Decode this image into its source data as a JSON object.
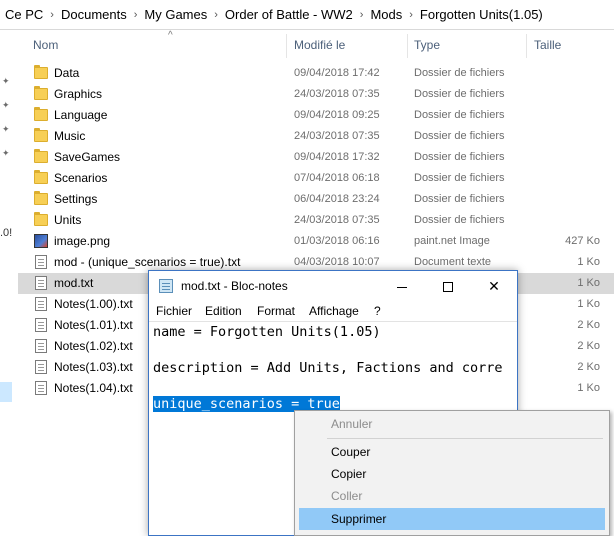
{
  "breadcrumb": [
    "Ce PC",
    "Documents",
    "My Games",
    "Order of Battle - WW2",
    "Mods",
    "Forgotten Units(1.05)"
  ],
  "breadcrumb_separator": "›",
  "nav_fragment": ".0!",
  "columns": {
    "name": "Nom",
    "date": "Modifié le",
    "type": "Type",
    "size": "Taille",
    "sort_indicator": "^"
  },
  "files": [
    {
      "name": "Data",
      "date": "09/04/2018 17:42",
      "type": "Dossier de fichiers",
      "size": "",
      "icon": "folder-icon"
    },
    {
      "name": "Graphics",
      "date": "24/03/2018 07:35",
      "type": "Dossier de fichiers",
      "size": "",
      "icon": "folder-icon"
    },
    {
      "name": "Language",
      "date": "09/04/2018 09:25",
      "type": "Dossier de fichiers",
      "size": "",
      "icon": "folder-icon"
    },
    {
      "name": "Music",
      "date": "24/03/2018 07:35",
      "type": "Dossier de fichiers",
      "size": "",
      "icon": "folder-icon"
    },
    {
      "name": "SaveGames",
      "date": "09/04/2018 17:32",
      "type": "Dossier de fichiers",
      "size": "",
      "icon": "folder-icon"
    },
    {
      "name": "Scenarios",
      "date": "07/04/2018 06:18",
      "type": "Dossier de fichiers",
      "size": "",
      "icon": "folder-icon"
    },
    {
      "name": "Settings",
      "date": "06/04/2018 23:24",
      "type": "Dossier de fichiers",
      "size": "",
      "icon": "folder-icon"
    },
    {
      "name": "Units",
      "date": "24/03/2018 07:35",
      "type": "Dossier de fichiers",
      "size": "",
      "icon": "folder-icon"
    },
    {
      "name": "image.png",
      "date": "01/03/2018 06:16",
      "type": "paint.net Image",
      "size": "427 Ko",
      "icon": "image-file-icon"
    },
    {
      "name": "mod - (unique_scenarios = true).txt",
      "date": "04/03/2018 10:07",
      "type": "Document texte",
      "size": "1 Ko",
      "icon": "text-file-icon"
    },
    {
      "name": "mod.txt",
      "date": "",
      "type": "",
      "size": "1 Ko",
      "icon": "text-file-icon"
    },
    {
      "name": "Notes(1.00).txt",
      "date": "",
      "type": "",
      "size": "1 Ko",
      "icon": "text-file-icon"
    },
    {
      "name": "Notes(1.01).txt",
      "date": "",
      "type": "",
      "size": "2 Ko",
      "icon": "text-file-icon"
    },
    {
      "name": "Notes(1.02).txt",
      "date": "",
      "type": "",
      "size": "2 Ko",
      "icon": "text-file-icon"
    },
    {
      "name": "Notes(1.03).txt",
      "date": "",
      "type": "",
      "size": "2 Ko",
      "icon": "text-file-icon"
    },
    {
      "name": "Notes(1.04).txt",
      "date": "",
      "type": "",
      "size": "1 Ko",
      "icon": "text-file-icon"
    }
  ],
  "notepad": {
    "title": "mod.txt - Bloc-notes",
    "menu": [
      "Fichier",
      "Edition",
      "Format",
      "Affichage",
      "?"
    ],
    "lines": [
      "name = Forgotten Units(1.05)",
      "",
      "description = Add Units, Factions and corre",
      "",
      "unique_scenarios = true"
    ],
    "selected_text": "unique_scenarios = true"
  },
  "context_menu": {
    "items": [
      {
        "label": "Annuler",
        "enabled": false
      },
      {
        "label": "Couper",
        "enabled": true
      },
      {
        "label": "Copier",
        "enabled": true
      },
      {
        "label": "Coller",
        "enabled": false
      },
      {
        "label": "Supprimer",
        "enabled": true,
        "highlighted": true
      }
    ]
  },
  "colors": {
    "selection": "#0078d7",
    "menu_highlight": "#91c9f7",
    "row_selected": "#d9d9d9",
    "folder": "#f7cf55",
    "header_text": "#4c607a"
  }
}
